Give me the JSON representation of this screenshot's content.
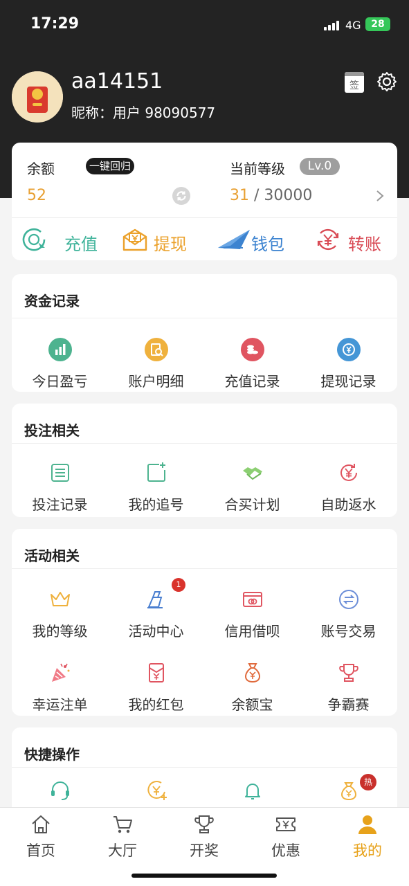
{
  "status_bar": {
    "time": "17:29",
    "network": "4G",
    "battery": "28"
  },
  "profile": {
    "username": "aa14151",
    "nickname": "昵称：用户 98090577",
    "sign_label": "签"
  },
  "balance": {
    "label": "余额",
    "one_key_return": "一键回归",
    "value": "52",
    "level_label": "当前等级",
    "level_badge": "Lv.0",
    "level_current": "31",
    "level_separator": " / ",
    "level_target": "30000"
  },
  "actions": {
    "recharge": "充值",
    "withdraw": "提现",
    "wallet": "钱包",
    "transfer": "转账"
  },
  "fund_records": {
    "title": "资金记录",
    "items": [
      {
        "label": "今日盈亏",
        "icon": "chart-icon"
      },
      {
        "label": "账户明细",
        "icon": "detail-icon"
      },
      {
        "label": "充值记录",
        "icon": "coins-icon"
      },
      {
        "label": "提现记录",
        "icon": "withdraw-icon"
      }
    ]
  },
  "betting": {
    "title": "投注相关",
    "items": [
      {
        "label": "投注记录",
        "icon": "list-icon"
      },
      {
        "label": "我的追号",
        "icon": "add-note-icon"
      },
      {
        "label": "合买计划",
        "icon": "handshake-icon"
      },
      {
        "label": "自助返水",
        "icon": "yen-refresh-icon"
      }
    ]
  },
  "activities": {
    "title": "活动相关",
    "items": [
      {
        "label": "我的等级",
        "icon": "crown-icon"
      },
      {
        "label": "活动中心",
        "icon": "activity-icon",
        "badge": "1"
      },
      {
        "label": "信用借呗",
        "icon": "credit-card-icon"
      },
      {
        "label": "账号交易",
        "icon": "exchange-icon"
      },
      {
        "label": "幸运注单",
        "icon": "party-icon"
      },
      {
        "label": "我的红包",
        "icon": "red-packet-icon"
      },
      {
        "label": "余额宝",
        "icon": "money-bag-icon"
      },
      {
        "label": "争霸赛",
        "icon": "trophy-icon"
      }
    ]
  },
  "quick_ops": {
    "title": "快捷操作",
    "items": [
      {
        "icon": "headset-icon"
      },
      {
        "icon": "yen-add-icon"
      },
      {
        "icon": "bell-icon"
      },
      {
        "icon": "money-bag-icon",
        "hot": "热"
      }
    ]
  },
  "tab_bar": {
    "tabs": [
      {
        "label": "首页",
        "icon": "home-icon"
      },
      {
        "label": "大厅",
        "icon": "cart-icon"
      },
      {
        "label": "开奖",
        "icon": "trophy-icon"
      },
      {
        "label": "优惠",
        "icon": "ticket-icon"
      },
      {
        "label": "我的",
        "icon": "user-icon",
        "active": true
      }
    ]
  },
  "colors": {
    "accent": "#e7a21b",
    "header": "#232323",
    "orange_value": "#e8a033"
  }
}
